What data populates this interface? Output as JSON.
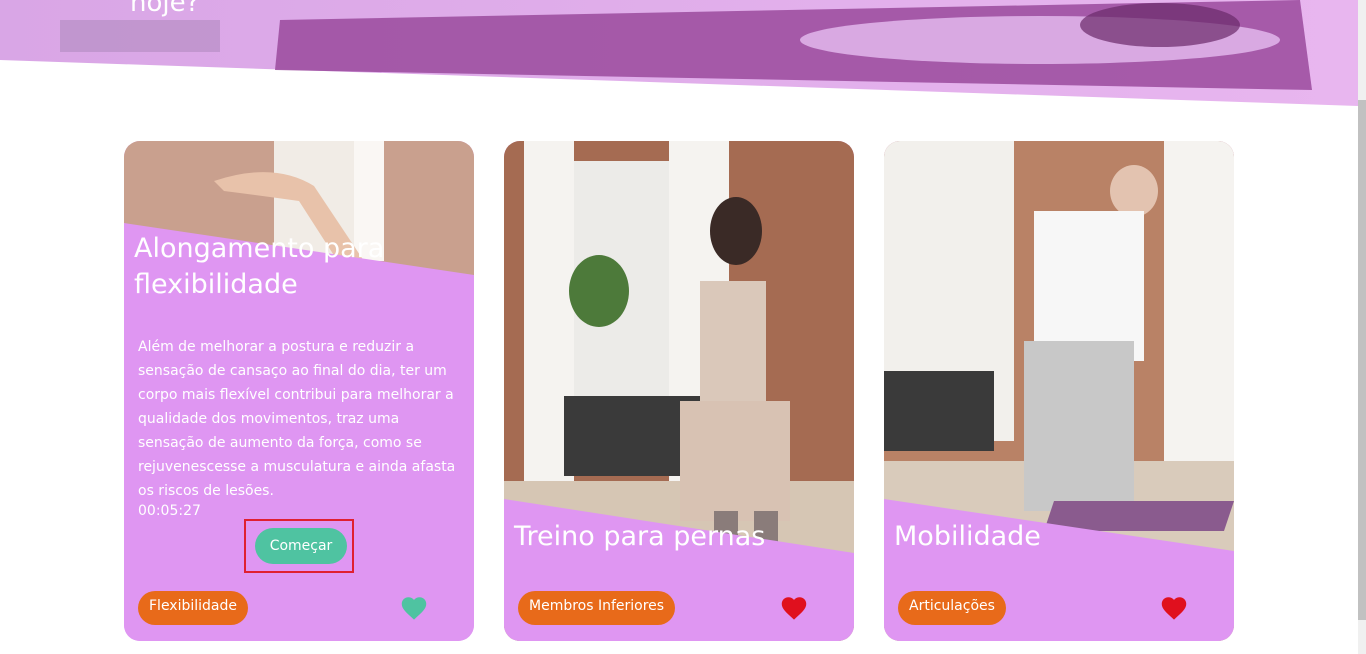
{
  "hero": {
    "text_fragment": "hoje?"
  },
  "cards": [
    {
      "title": "Alongamento para flexibilidade",
      "description": "Além de melhorar a postura e reduzir a sensação de cansaço ao final do dia, ter um corpo mais flexível contribui para melhorar a qualidade dos movimentos, traz uma sensação de aumento da força, como se rejuvenescesse a musculatura e ainda afasta os riscos de lesões.",
      "duration": "00:05:27",
      "button_label": "Começar",
      "tag": "Flexibilidade",
      "favorite_color": "#4fc3a1"
    },
    {
      "title": "Treino para pernas",
      "tag": "Membros Inferiores",
      "favorite_color": "#e0101e"
    },
    {
      "title": "Mobilidade",
      "tag": "Articulações",
      "favorite_color": "#e0101e"
    }
  ],
  "colors": {
    "card_bg": "#df96f2",
    "tag_bg": "#e86a1a",
    "button_bg": "#4fc3a1",
    "highlight_border": "#e02030"
  },
  "icons": {
    "favorite": "heart-icon"
  }
}
